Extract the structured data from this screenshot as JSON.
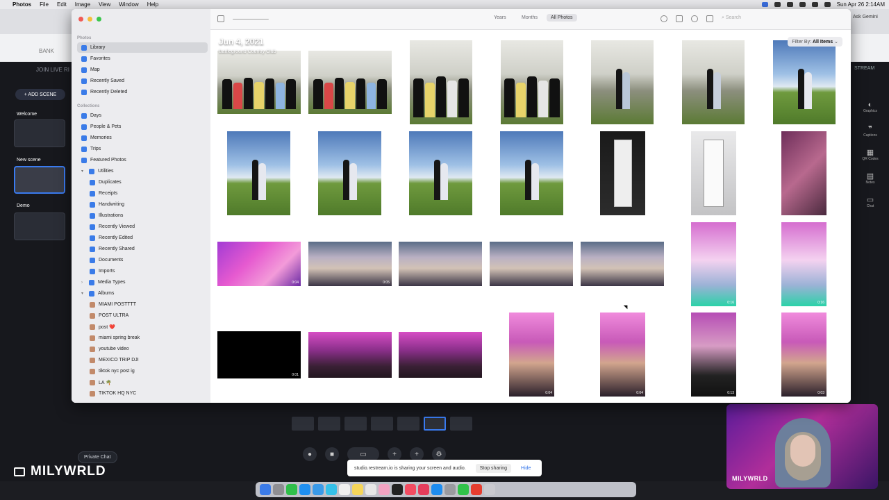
{
  "menubar": {
    "app": "Photos",
    "items": [
      "File",
      "Edit",
      "Image",
      "View",
      "Window",
      "Help"
    ],
    "datetime": "Sun Apr 26  2:14AM"
  },
  "background_app": {
    "join_text": "JOIN LIVE RI",
    "add_scene": "+ ADD SCENE",
    "scenes": [
      "Welcome",
      "New scene",
      "Demo"
    ],
    "stream_label": "STREAM",
    "ask_gemini": "Ask Gemini",
    "bank_tab": "BANK",
    "right_rail": [
      "Graphics",
      "Captions",
      "QR Codes",
      "Notes",
      "Chat"
    ],
    "private_chat": "Private Chat",
    "brand": "MILYWRLD"
  },
  "share_bar": {
    "message": "studio.restream.io is sharing your screen and audio.",
    "stop": "Stop sharing",
    "hide": "Hide"
  },
  "webcam": {
    "name": "MILYWRLD"
  },
  "photos": {
    "sidebar": {
      "photos_header": "Photos",
      "photos_items": [
        "Library",
        "Favorites",
        "Map",
        "Recently Saved",
        "Recently Deleted"
      ],
      "collections_header": "Collections",
      "collections_items": [
        "Days",
        "People & Pets",
        "Memories",
        "Trips",
        "Featured Photos",
        "Utilities"
      ],
      "utilities_items": [
        "Duplicates",
        "Receipts",
        "Handwriting",
        "Illustrations",
        "Recently Viewed",
        "Recently Edited",
        "Recently Shared",
        "Documents",
        "Imports"
      ],
      "media_types": "Media Types",
      "albums": "Albums",
      "album_items": [
        "MIAMI POSTTTT",
        "POST ULTRA",
        "post ❤️",
        "miami spring break",
        "youtube video",
        "MEXICO TRIP DJI",
        "tiktok nyc post ig",
        "LA 🌴",
        "TIKTOK HQ NYC"
      ]
    },
    "toolbar": {
      "segments": [
        "Years",
        "Months",
        "All Photos"
      ],
      "selected": "All Photos",
      "search_placeholder": "Search"
    },
    "date_header": "Jun 4, 2021",
    "location": "Battleground Country Club",
    "filter": {
      "label": "Filter By:",
      "value": "All Items"
    },
    "video_durations": [
      "0:04",
      "0:05",
      "0:16",
      "0:16",
      "0:01",
      "0:04",
      "0:04",
      "0:13",
      "0:03"
    ]
  }
}
